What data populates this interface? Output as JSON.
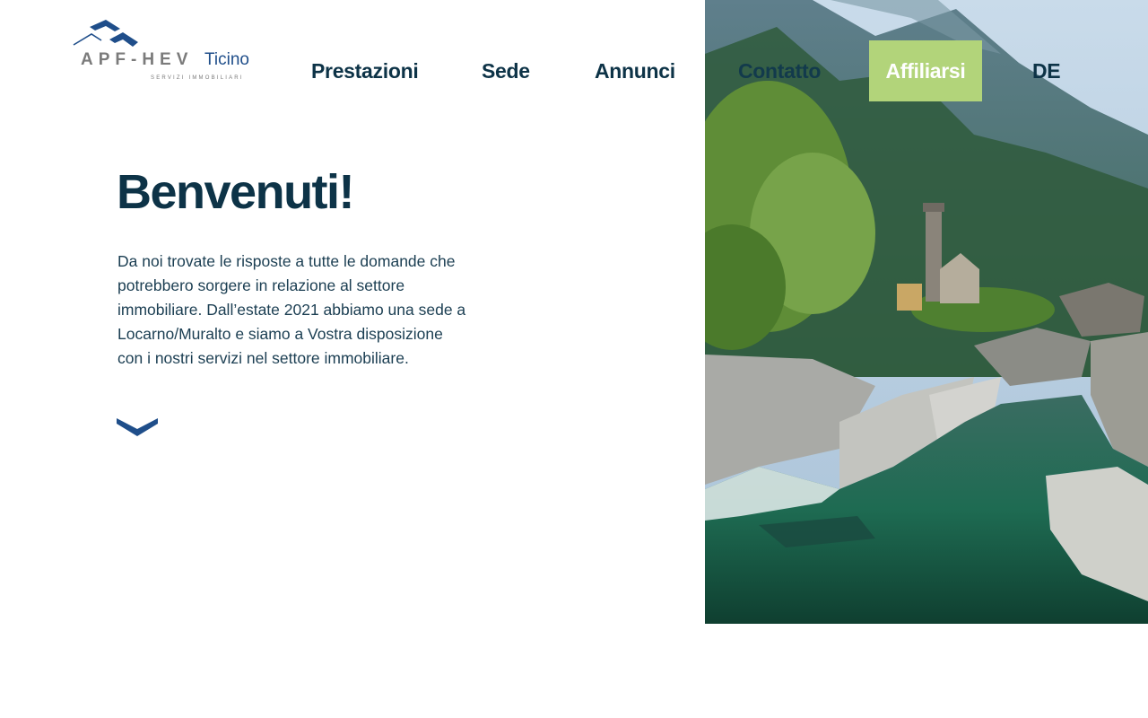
{
  "brand": {
    "name": "APF-HEV",
    "region": "Ticino",
    "tagline": "SERVIZI IMMOBILIARI",
    "colors": {
      "navy": "#0d3347",
      "blue": "#1f4e8a",
      "gray": "#7b7b7b",
      "green": "#b2d47a"
    }
  },
  "nav": {
    "items": [
      {
        "label": "Prestazioni"
      },
      {
        "label": "Sede"
      },
      {
        "label": "Annunci"
      },
      {
        "label": "Contatto"
      }
    ],
    "cta": "Affiliarsi",
    "language": "DE"
  },
  "main": {
    "title": "Benvenuti!",
    "intro_lines": [
      "Da noi trovate le risposte a tutte le domande che",
      "potrebbero sorgere in relazione al settore",
      "immobiliare. Dall’estate 2021 abbiamo una sede a",
      "Locarno/Muralto e siamo a Vostra disposizione",
      "con i nostri servizi nel settore immobiliare."
    ],
    "scroll_icon": "chevron-down-icon"
  },
  "hero": {
    "image": "valley-river-church-photo"
  }
}
